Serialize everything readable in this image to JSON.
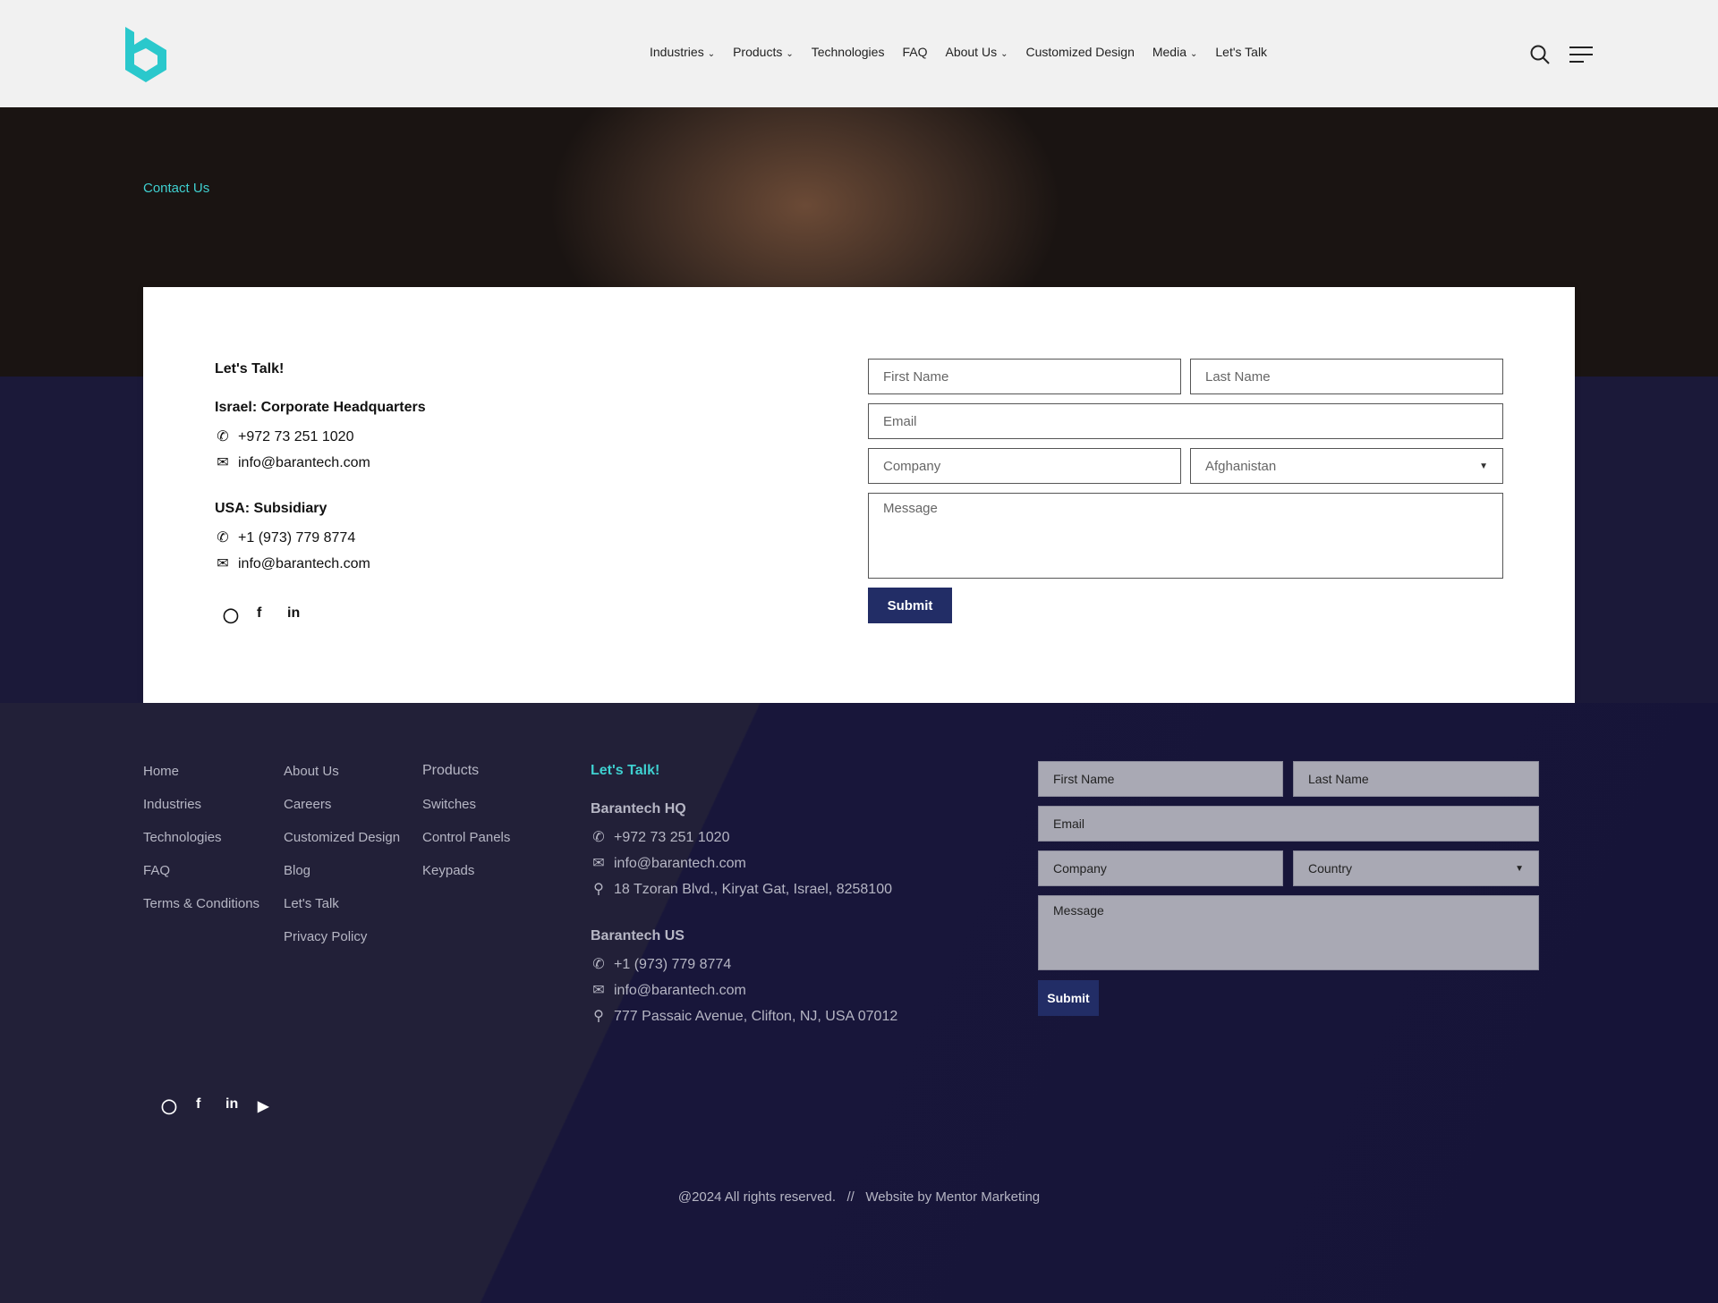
{
  "header": {
    "logo": "b",
    "nav": [
      {
        "label": "Industries",
        "dropdown": true
      },
      {
        "label": "Products",
        "dropdown": true
      },
      {
        "label": "Technologies",
        "dropdown": false
      },
      {
        "label": "FAQ",
        "dropdown": false
      },
      {
        "label": "About Us",
        "dropdown": true
      },
      {
        "label": "Customized Design",
        "dropdown": false
      },
      {
        "label": "Media",
        "dropdown": true
      },
      {
        "label": "Let's Talk",
        "dropdown": false
      }
    ]
  },
  "breadcrumb": "Contact Us",
  "contact": {
    "title": "Let's Talk!",
    "israel": {
      "heading": "Israel: Corporate Headquarters",
      "phone": "+972 73 251 1020",
      "email": "info@barantech.com"
    },
    "usa": {
      "heading": "USA: Subsidiary",
      "phone": "+1 (973) 779 8774",
      "email": "info@barantech.com"
    }
  },
  "form": {
    "first_name": "First Name",
    "last_name": "Last Name",
    "email": "Email",
    "company": "Company",
    "country": "Afghanistan",
    "message": "Message",
    "submit": "Submit"
  },
  "footer": {
    "col1": [
      "Home",
      "Industries",
      "Technologies",
      "FAQ",
      "Terms & Conditions"
    ],
    "col2": [
      "About Us",
      "Careers",
      "Customized Design",
      "Blog",
      "Let's Talk",
      "Privacy Policy"
    ],
    "col3": [
      "Products",
      "Switches",
      "Control Panels",
      "Keypads"
    ],
    "talk_title": "Let's Talk!",
    "hq": {
      "heading": "Barantech HQ",
      "phone": "+972 73 251 1020",
      "email": "info@barantech.com",
      "address": "18 Tzoran Blvd., Kiryat Gat, Israel, 8258100"
    },
    "us": {
      "heading": "Barantech US",
      "phone": "+1 (973) 779 8774",
      "email": "info@barantech.com",
      "address": "777 Passaic Avenue, Clifton, NJ, USA 07012"
    },
    "form": {
      "first_name": "First Name",
      "last_name": "Last Name",
      "email": "Email",
      "company": "Company",
      "country": "Country",
      "message": "Message",
      "submit": "Submit"
    },
    "copyright": "@2024 All rights reserved.   //   Website by Mentor Marketing"
  },
  "colors": {
    "accent": "#3fd0d0",
    "button": "#222d66",
    "footer": "#1b1939"
  }
}
